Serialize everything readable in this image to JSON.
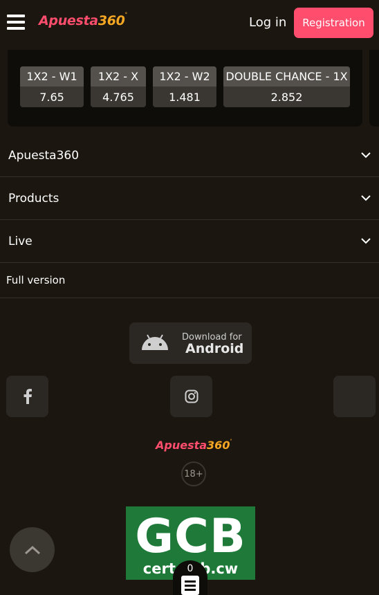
{
  "header": {
    "logo_part1": "Apuesta",
    "logo_part2": "360",
    "logo_mark": "°",
    "login_label": "Log in",
    "register_label": "Registration"
  },
  "odds": [
    {
      "label": "1X2 - W1",
      "value": "7.65"
    },
    {
      "label": "1X2 - X",
      "value": "4.765"
    },
    {
      "label": "1X2 - W2",
      "value": "1.481"
    },
    {
      "label": "DOUBLE CHANCE - 1X",
      "value": "2.852"
    }
  ],
  "accordion": [
    {
      "label": "Apuesta360",
      "icon": "chevron-down-icon"
    },
    {
      "label": "Products",
      "icon": "chevron-down-icon"
    },
    {
      "label": "Live",
      "icon": "chevron-down-icon"
    }
  ],
  "full_version_label": "Full version",
  "android": {
    "small_label": "Download for",
    "big_label": "Android",
    "icon": "android-icon"
  },
  "social": [
    "facebook-icon",
    "instagram-icon",
    "social-icon"
  ],
  "footer": {
    "logo_part1": "Apuesta",
    "logo_part2": "360",
    "logo_mark": "°",
    "age_label": "18+"
  },
  "gcb": {
    "title": "GCB",
    "subtitle": "cert.gcb.cw"
  },
  "betslip": {
    "count": "0"
  },
  "colors": {
    "accent": "#ff4d6d",
    "logo_orange": "#f5a623",
    "background": "#1b1710",
    "gcb_green": "#1f7a3a"
  }
}
